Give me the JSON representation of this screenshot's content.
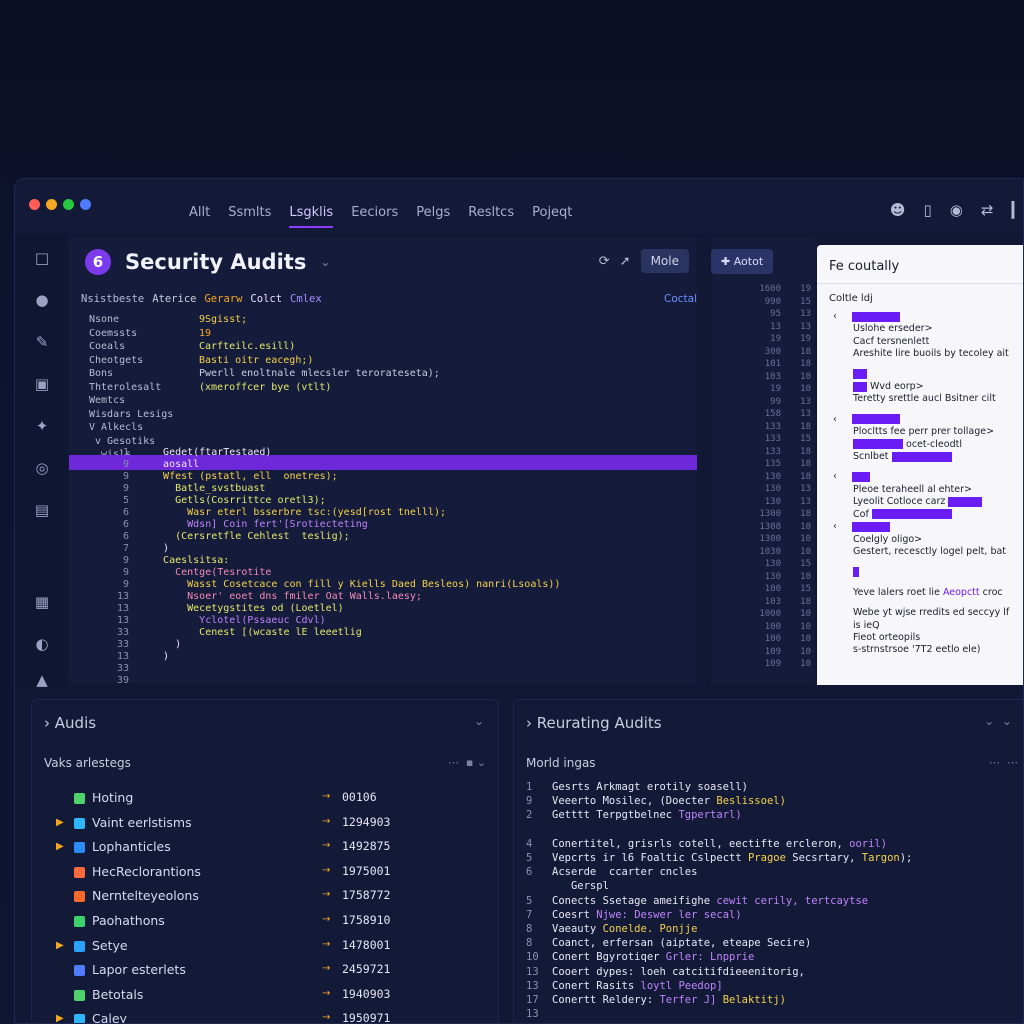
{
  "window": {
    "dots": [
      "#ff5f56",
      "#f5a623",
      "#27c93f",
      "#4f7bff"
    ],
    "nav_tabs": [
      {
        "label": "Allt"
      },
      {
        "label": "Ssmlts"
      },
      {
        "label": "Lsgklis"
      },
      {
        "label": "Eeciors"
      },
      {
        "label": "Pelgs"
      },
      {
        "label": "Resltcs"
      },
      {
        "label": "Pojeqt"
      }
    ],
    "active_tab": 2,
    "toolbar_icons": [
      "user-icon",
      "phone-icon",
      "shield-icon",
      "swap-icon",
      "sidebar-icon"
    ]
  },
  "rail_icons": [
    "file-icon",
    "pin-icon",
    "edit-icon",
    "bookmark-icon",
    "puzzle-icon",
    "globe-icon",
    "message-icon",
    "layers-icon",
    "compass-icon",
    "folder-icon"
  ],
  "editor": {
    "badge": "6",
    "title": "Security Audits",
    "more_label": "Mole",
    "headers": [
      "Nsistbeste",
      "Aterice",
      "Gerarw",
      "Colct",
      "Cmlex"
    ],
    "code_label": "Coctal",
    "tree_keys": [
      "Nsone",
      "Coemssts",
      "Coeals",
      "Cheotgets",
      "Bons",
      "Thterolesalt",
      "Wemtcs",
      "Wisdars Lesigs",
      "V Alkecls",
      "v Gesotiks",
      "wisls"
    ],
    "tree_values": [
      "9Sgisst;",
      "19",
      "Carfteilc.esill)",
      "Basti oitr eacegh;)",
      "Pwerll enoltnale mlecsler terorateseta);",
      "(xmeroffcer bye (vtlt)"
    ],
    "gutter": [
      "1",
      "9",
      "9",
      "9",
      "5",
      "6",
      "6",
      "6",
      "7",
      "9",
      "9",
      "9",
      "13",
      "13",
      "13",
      "33",
      "33",
      "13",
      "33",
      "39"
    ],
    "code_lines": [
      {
        "text": "   Gedet(ftarTestaed)",
        "cls": "c0"
      },
      {
        "text": "   aosall",
        "cls": "c0"
      },
      {
        "text": "   Wfest (pstatl, ell  onetres);",
        "cls": "c1"
      },
      {
        "text": "     Batle_svstbuast",
        "cls": "c3"
      },
      {
        "text": "     Getls(Cosrrittce oretl3);",
        "cls": "c3"
      },
      {
        "text": "       Wasr eterl bsserbre tsc:(yesd[rost tnelll);",
        "cls": "c1"
      },
      {
        "text": "       Wdsn] Coin fert'[Srotiecteting",
        "cls": "c2"
      },
      {
        "text": "     (Cersretfle Cehlest  teslig);",
        "cls": "c3"
      },
      {
        "text": "   )",
        "cls": "c0"
      },
      {
        "text": "   Caeslsitsa:",
        "cls": "c3"
      },
      {
        "text": "     Centge(Tesrotite",
        "cls": "c4"
      },
      {
        "text": "       Wasst Cosetcace con fill y Kiells Daed Besleos) nanri(Lsoals))",
        "cls": "c1"
      },
      {
        "text": "       Nsoer' eoet dns fmiler Oat Walls.laesy;",
        "cls": "c4"
      },
      {
        "text": "       Wecetygstites od (Loetlel)",
        "cls": "c3"
      },
      {
        "text": "         Yclotel(Pssaeuc Cdvl)",
        "cls": "c2"
      },
      {
        "text": "         Cenest [(wcaste lE leeetlig",
        "cls": "c3"
      },
      {
        "text": "     )",
        "cls": "c0"
      },
      {
        "text": "   )",
        "cls": "c0"
      }
    ]
  },
  "middle": {
    "add_label": "Aotot",
    "nums_a": [
      "1600",
      "990",
      "95",
      "13",
      "19",
      "300",
      "101",
      "103",
      "19",
      "99",
      "158",
      "133",
      "133",
      "133",
      "135",
      "130",
      "130",
      "130",
      "1300",
      "1308",
      "1300",
      "1030",
      "130",
      "130",
      "100",
      "103",
      "1000",
      "100",
      "100",
      "109",
      "109"
    ],
    "nums_b": [
      "19",
      "15",
      "13",
      "13",
      "19",
      "18",
      "18",
      "10",
      "10",
      "13",
      "13",
      "18",
      "15",
      "18",
      "18",
      "18",
      "13",
      "13",
      "18",
      "10",
      "10",
      "10",
      "15",
      "10",
      "15",
      "18",
      "10",
      "10",
      "10",
      "10",
      "10"
    ]
  },
  "panel": {
    "title": "Fe coutally",
    "label": "Coltle ldj",
    "lines": [
      {
        "t": "bar",
        "w": 48,
        "chev": true
      },
      {
        "t": "text",
        "v": "Uslohe erseder>"
      },
      {
        "t": "text",
        "v": "Cacf tersnenlett"
      },
      {
        "t": "text",
        "v": "Areshite lire buoils by tecoley ait"
      },
      {
        "t": "gap"
      },
      {
        "t": "bar",
        "w": 14
      },
      {
        "t": "bar",
        "w": 14,
        "after": "Wvd eorp>"
      },
      {
        "t": "text",
        "v": "Teretty srettle aucl Bsitner cilt"
      },
      {
        "t": "gap"
      },
      {
        "t": "bar",
        "w": 48,
        "chev": true
      },
      {
        "t": "text",
        "v": "Plocltts fee perr prer tollage>"
      },
      {
        "t": "bar",
        "w": 50,
        "after": "ocet-cleodtl"
      },
      {
        "t": "bartext",
        "v": "Scnlbet",
        "w": 60
      },
      {
        "t": "gap"
      },
      {
        "t": "bar",
        "w": 18,
        "chev": true
      },
      {
        "t": "text",
        "v": "Pleoe teraheell al ehter>"
      },
      {
        "t": "bartext",
        "v": "Lyeolit Cotloce carz",
        "w": 34
      },
      {
        "t": "bartext",
        "v": "Cof",
        "w": 80
      },
      {
        "t": "bar",
        "w": 38,
        "chev": true
      },
      {
        "t": "text",
        "v": "Coelgly oligo>"
      },
      {
        "t": "text",
        "v": "Gestert, recesctly logel pelt, bat"
      },
      {
        "t": "gap"
      },
      {
        "t": "bar",
        "w": 6
      },
      {
        "t": "gap"
      },
      {
        "t": "pv",
        "v": "Yeve lalers roet lie ",
        "p": "Aeopctt",
        "e": " croc"
      },
      {
        "t": "gap"
      },
      {
        "t": "text",
        "v": "Webe yt wjse rredits ed seccyy lf"
      },
      {
        "t": "text",
        "v": "    is    ieQ"
      },
      {
        "t": "text",
        "v": "Fieot orteopils"
      },
      {
        "t": "text",
        "v": "  s-strnstrsoe '7T2 eetlo ele)"
      }
    ]
  },
  "audits": {
    "title": "Audis",
    "subtitle": "Vaks arlestegs",
    "rows": [
      {
        "name": "Hoting",
        "num": "00106",
        "color": "#4fd16b",
        "arrow": false
      },
      {
        "name": "Vaint eerlstisms",
        "num": "1294903",
        "color": "#2fb6ff",
        "arrow": true
      },
      {
        "name": "Lophanticles",
        "num": "1492875",
        "color": "#2a8cff",
        "arrow": true
      },
      {
        "name": "HecReclorantions",
        "num": "1975001",
        "color": "#ff6a3d",
        "arrow": false
      },
      {
        "name": "Nerntelteyeolons",
        "num": "1758772",
        "color": "#ff6a2a",
        "arrow": false
      },
      {
        "name": "Paohathons",
        "num": "1758910",
        "color": "#3bd16b",
        "arrow": false
      },
      {
        "name": "Setye",
        "num": "1478001",
        "color": "#2aa3ff",
        "arrow": true
      },
      {
        "name": "Lapor esterlets",
        "num": "2459721",
        "color": "#4e7bff",
        "arrow": false
      },
      {
        "name": "Betotals",
        "num": "1940903",
        "color": "#4fd16b",
        "arrow": false
      },
      {
        "name": "Caley",
        "num": "1950971",
        "color": "#2fb6ff",
        "arrow": true
      }
    ]
  },
  "reports": {
    "title": "Reurating Audits",
    "subtitle": "Morld ingas",
    "lines": [
      {
        "n": "1",
        "parts": [
          [
            "w",
            "Gesrts Arkmagt erotily soasell)"
          ]
        ]
      },
      {
        "n": "9",
        "parts": [
          [
            "w",
            "Veeerto Mosilec, (Doecter "
          ],
          [
            "y",
            "Beslissoel)"
          ]
        ]
      },
      {
        "n": "2",
        "parts": [
          [
            "w",
            "Getttt Terpgtbelnec "
          ],
          [
            "p",
            "Tgpertarl)"
          ]
        ]
      },
      {
        "n": "",
        "parts": [
          [
            "w",
            ""
          ]
        ]
      },
      {
        "n": "4",
        "parts": [
          [
            "w",
            "Conertitel, grisrls cotell, eectifte ercleron, "
          ],
          [
            "p",
            "ooril)"
          ]
        ]
      },
      {
        "n": "5",
        "parts": [
          [
            "w",
            "Vepcrts ir l6 "
          ],
          [
            "w",
            "Foaltic Cslpectt "
          ],
          [
            "y",
            "Pragoe"
          ],
          [
            "w",
            " Secsrtary, "
          ],
          [
            "y",
            "Targon"
          ],
          [
            "w",
            ");"
          ]
        ]
      },
      {
        "n": "6",
        "parts": [
          [
            "w",
            "Acserde  ccarter cncles"
          ]
        ]
      },
      {
        "n": "",
        "parts": [
          [
            "w",
            "   Gerspl"
          ]
        ]
      },
      {
        "n": "5",
        "parts": [
          [
            "w",
            "Conects Ssetage ameifighe "
          ],
          [
            "p",
            "cewit cerily, tertcaytse"
          ]
        ]
      },
      {
        "n": "7",
        "parts": [
          [
            "w",
            "Coesrt "
          ],
          [
            "p",
            "Njwe: Deswer ler secal)"
          ]
        ]
      },
      {
        "n": "8",
        "parts": [
          [
            "w",
            "Vaeauty "
          ],
          [
            "y",
            "Conelde. Ponjje"
          ]
        ]
      },
      {
        "n": "8",
        "parts": [
          [
            "w",
            "Coanct, "
          ],
          [
            "w",
            "erfersan (aiptate, eteape Secire)"
          ]
        ]
      },
      {
        "n": "10",
        "parts": [
          [
            "w",
            "Conert Bgyrotiqer "
          ],
          [
            "p",
            "Grler: Lnpprie"
          ]
        ]
      },
      {
        "n": "13",
        "parts": [
          [
            "w",
            "Cooert dypes: loeh catcitifdieeenitorig,"
          ]
        ]
      },
      {
        "n": "13",
        "parts": [
          [
            "w",
            "Conert Rasits "
          ],
          [
            "p",
            "loytl Peedop]"
          ]
        ]
      },
      {
        "n": "17",
        "parts": [
          [
            "w",
            "Conertt Reldery: "
          ],
          [
            "p",
            "Terfer J] "
          ],
          [
            "y",
            "Belaktitj)"
          ]
        ]
      },
      {
        "n": "13",
        "parts": [
          [
            "w",
            ""
          ]
        ]
      }
    ]
  }
}
